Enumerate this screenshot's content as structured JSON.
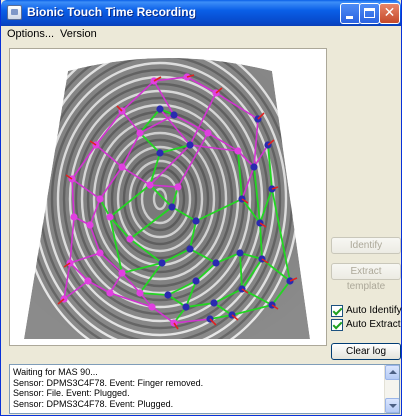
{
  "window": {
    "title": "Bionic Touch Time Recording",
    "icon": "app-icon",
    "controls": [
      "minimize-icon",
      "maximize-icon",
      "close-icon"
    ]
  },
  "menu": {
    "options_label": "Options...",
    "version_label": "Version"
  },
  "fingerprint": {
    "image": "fingerprint-scan",
    "minutiae_colors": {
      "magenta": "#e040e0",
      "blue": "#2a2ab0",
      "red": "#e02020"
    },
    "match_line_color": "#22d622",
    "template_line_color": "#d232d2"
  },
  "buttons": {
    "identify": "Identify",
    "extract_template": "Extract template",
    "clear_log": "Clear log"
  },
  "checkboxes": {
    "auto_identify": {
      "label": "Auto Identify",
      "checked": true
    },
    "auto_extract": {
      "label": "Auto Extract",
      "checked": true
    }
  },
  "log": {
    "lines": [
      "Waiting for MAS 90...",
      "Sensor: DPMS3C4F78. Event: Finger removed.",
      "Sensor: File. Event: Plugged.",
      "Sensor: DPMS3C4F78. Event: Plugged."
    ]
  }
}
